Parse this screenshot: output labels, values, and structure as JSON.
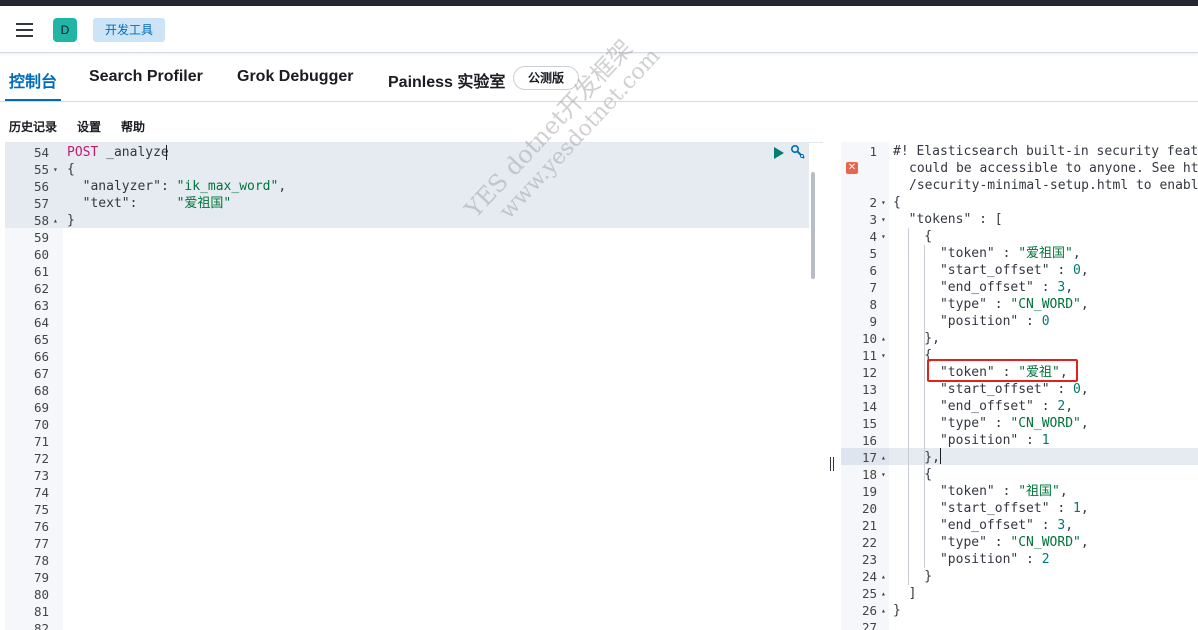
{
  "header": {
    "avatar_letter": "D",
    "breadcrumb": "开发工具"
  },
  "tabs": [
    {
      "label": "控制台",
      "active": true
    },
    {
      "label": "Search Profiler"
    },
    {
      "label": "Grok Debugger"
    },
    {
      "label": "Painless 实验室"
    }
  ],
  "beta_badge": "公测版",
  "subnav": {
    "history": "历史记录",
    "settings": "设置",
    "help": "帮助"
  },
  "request_editor": {
    "method": "POST",
    "endpoint": "_analyze",
    "analyzer_key": "\"analyzer\"",
    "analyzer_value": "\"ik_max_word\"",
    "text_key": "\"text\"",
    "text_value": "\"爱祖国\"",
    "line_numbers": [
      "54",
      "55",
      "56",
      "57",
      "58",
      "59",
      "60",
      "61",
      "62",
      "63",
      "64",
      "65",
      "66",
      "67",
      "68",
      "69",
      "70",
      "71",
      "72",
      "73",
      "74",
      "75",
      "76",
      "77",
      "78",
      "79",
      "80",
      "81",
      "82"
    ]
  },
  "response_editor": {
    "comment_line1": "#! Elasticsearch built-in security featu",
    "comment_line2": "could be accessible to anyone. See htt",
    "comment_line3": "/security-minimal-setup.html to enable",
    "line_numbers": [
      "1",
      "",
      "",
      "2",
      "3",
      "4",
      "5",
      "6",
      "7",
      "8",
      "9",
      "10",
      "11",
      "12",
      "13",
      "14",
      "15",
      "16",
      "17",
      "18",
      "19",
      "20",
      "21",
      "22",
      "23",
      "24",
      "25",
      "26",
      "27"
    ],
    "tokens": [
      {
        "token": "\"爱祖国\"",
        "start_offset": "0",
        "end_offset": "3",
        "type": "\"CN_WORD\"",
        "position": "0"
      },
      {
        "token": "\"爱祖\"",
        "start_offset": "0",
        "end_offset": "2",
        "type": "\"CN_WORD\"",
        "position": "1"
      },
      {
        "token": "\"祖国\"",
        "start_offset": "1",
        "end_offset": "3",
        "type": "\"CN_WORD\"",
        "position": "2"
      }
    ]
  },
  "watermark": {
    "line1": "YES dotnet开发框架",
    "line2": "www.yesdotnet.com"
  },
  "colors": {
    "accent": "#006bb8",
    "method": "#c41a6a",
    "string": "#00733a",
    "number": "#007871",
    "highlight_box": "#e0231c"
  }
}
